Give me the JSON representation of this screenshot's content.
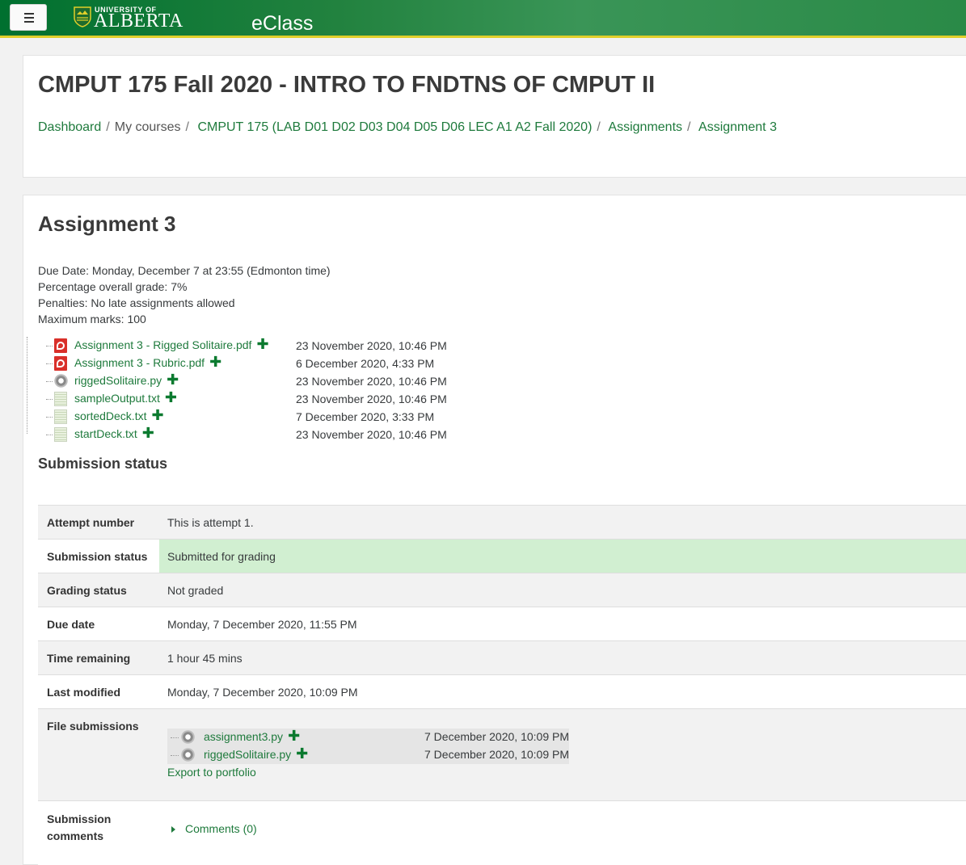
{
  "navbar": {
    "menu_icon": "hamburger-menu-icon",
    "university_top": "UNIVERSITY OF",
    "university_main": "ALBERTA",
    "app_name": "eClass",
    "colors": {
      "primary": "#00702f",
      "accent": "#e0cf2a"
    }
  },
  "header": {
    "course_title": "CMPUT 175 Fall 2020 - INTRO TO FNDTNS OF CMPUT II",
    "breadcrumb": [
      {
        "label": "Dashboard",
        "link": true
      },
      {
        "label": "My courses",
        "link": false
      },
      {
        "label": "CMPUT 175 (LAB D01 D02 D03 D04 D05 D06 LEC A1 A2 Fall 2020)",
        "link": true
      },
      {
        "label": "Assignments",
        "link": true
      },
      {
        "label": "Assignment 3",
        "link": true
      }
    ]
  },
  "assignment": {
    "title": "Assignment 3",
    "intro": [
      "Due Date: Monday, December 7 at 23:55 (Edmonton time)",
      "Percentage overall grade: 7%",
      "Penalties: No late assignments allowed",
      "Maximum marks: 100"
    ],
    "files": [
      {
        "name": "Assignment 3 - Rigged Solitaire.pdf",
        "icon": "pdf-icon",
        "date": "23 November 2020, 10:46 PM"
      },
      {
        "name": "Assignment 3 - Rubric.pdf",
        "icon": "pdf-icon",
        "date": "6 December 2020, 4:33 PM"
      },
      {
        "name": "riggedSolitaire.py",
        "icon": "script-gear-icon",
        "date": "23 November 2020, 10:46 PM"
      },
      {
        "name": "sampleOutput.txt",
        "icon": "text-file-icon",
        "date": "23 November 2020, 10:46 PM"
      },
      {
        "name": "sortedDeck.txt",
        "icon": "text-file-icon",
        "date": "7 December 2020, 3:33 PM"
      },
      {
        "name": "startDeck.txt",
        "icon": "text-file-icon",
        "date": "23 November 2020, 10:46 PM"
      }
    ]
  },
  "submission": {
    "heading": "Submission status",
    "rows": {
      "attempt_label": "Attempt number",
      "attempt_value": "This is attempt 1.",
      "status_label": "Submission status",
      "status_value": "Submitted for grading",
      "grading_label": "Grading status",
      "grading_value": "Not graded",
      "due_label": "Due date",
      "due_value": "Monday, 7 December 2020, 11:55 PM",
      "remaining_label": "Time remaining",
      "remaining_value": "1 hour 45 mins",
      "modified_label": "Last modified",
      "modified_value": "Monday, 7 December 2020, 10:09 PM",
      "files_label": "File submissions",
      "comments_label": "Submission comments",
      "comments_link": "Comments (0)",
      "export_link": "Export to portfolio"
    },
    "files": [
      {
        "name": "assignment3.py",
        "icon": "script-gear-icon",
        "date": "7 December 2020, 10:09 PM"
      },
      {
        "name": "riggedSolitaire.py",
        "icon": "script-gear-icon",
        "date": "7 December 2020, 10:09 PM"
      }
    ],
    "colors": {
      "success_bg": "#d1efd1"
    }
  }
}
